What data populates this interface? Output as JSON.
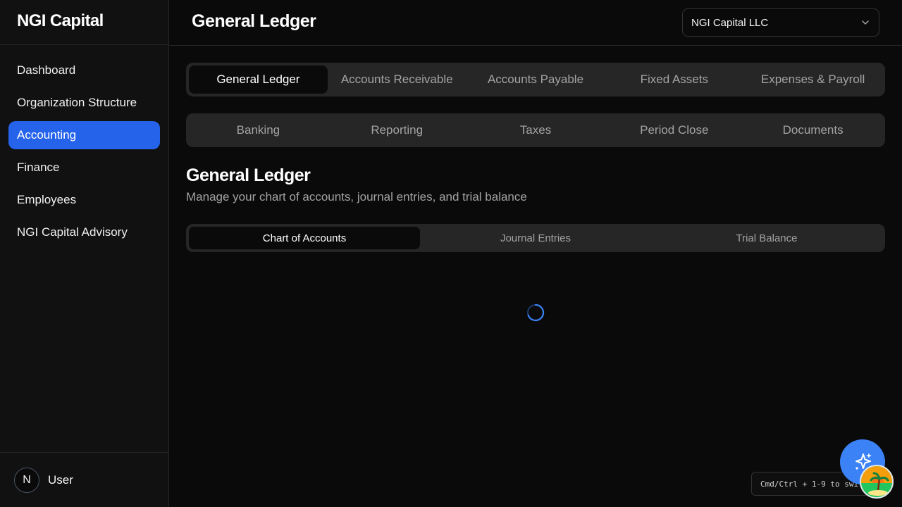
{
  "sidebar": {
    "brand": "NGI Capital",
    "items": [
      {
        "label": "Dashboard"
      },
      {
        "label": "Organization Structure"
      },
      {
        "label": "Accounting"
      },
      {
        "label": "Finance"
      },
      {
        "label": "Employees"
      },
      {
        "label": "NGI Capital Advisory"
      }
    ],
    "active_index": 2,
    "user": {
      "initial": "N",
      "name": "User"
    }
  },
  "header": {
    "title": "General Ledger",
    "entity_select": {
      "value": "NGI Capital LLC",
      "icon": "chevron-down-icon"
    }
  },
  "main": {
    "primary_tabs": [
      {
        "label": "General Ledger"
      },
      {
        "label": "Accounts Receivable"
      },
      {
        "label": "Accounts Payable"
      },
      {
        "label": "Fixed Assets"
      },
      {
        "label": "Expenses & Payroll"
      }
    ],
    "secondary_tabs": [
      {
        "label": "Banking"
      },
      {
        "label": "Reporting"
      },
      {
        "label": "Taxes"
      },
      {
        "label": "Period Close"
      },
      {
        "label": "Documents"
      }
    ],
    "section": {
      "title": "General Ledger",
      "subtitle": "Manage your chart of accounts, journal entries, and trial balance"
    },
    "sub_tabs": [
      {
        "label": "Chart of Accounts"
      },
      {
        "label": "Journal Entries"
      },
      {
        "label": "Trial Balance"
      }
    ]
  },
  "floating": {
    "shortcut_hint": "Cmd/Ctrl + 1-9 to switch",
    "assistant_icon": "sparkles-icon"
  },
  "colors": {
    "accent": "#2563eb",
    "fab": "#3b82f6",
    "background": "#0a0a0a",
    "sidebar_bg": "#111111",
    "tab_bg": "#262626"
  }
}
